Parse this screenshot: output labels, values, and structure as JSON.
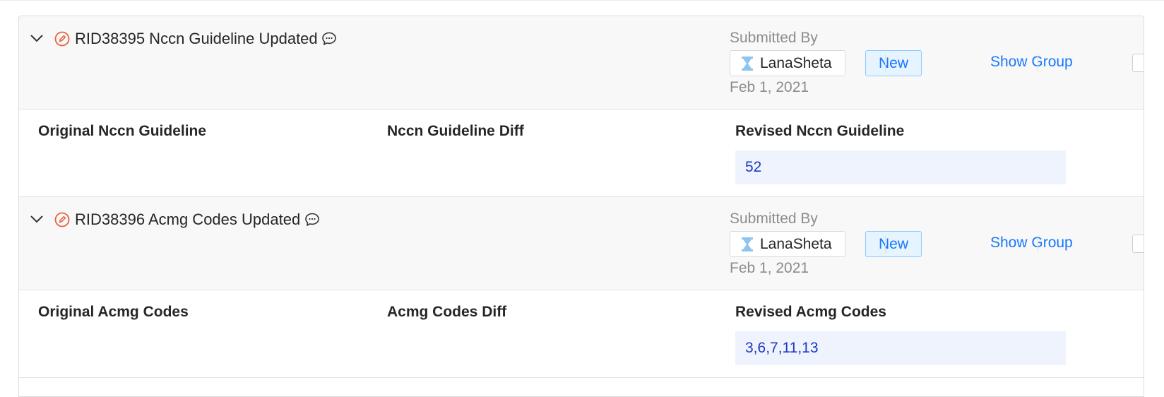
{
  "records": [
    {
      "title": "RID38395 Nccn Guideline Updated",
      "submitted_label": "Submitted By",
      "user": "LanaSheta",
      "status": "New",
      "show_group_label": "Show Group",
      "date": "Feb 1, 2021",
      "original_label": "Original Nccn Guideline",
      "diff_label": "Nccn Guideline Diff",
      "revised_label": "Revised Nccn Guideline",
      "revised_value": "52",
      "checked": false
    },
    {
      "title": "RID38396 Acmg Codes Updated",
      "submitted_label": "Submitted By",
      "user": "LanaSheta",
      "status": "New",
      "show_group_label": "Show Group",
      "date": "Feb 1, 2021",
      "original_label": "Original Acmg Codes",
      "diff_label": "Acmg Codes Diff",
      "revised_label": "Revised Acmg Codes",
      "revised_value": "3,6,7,11,13",
      "checked": false
    }
  ],
  "icons": {
    "collapse": "chevron-down-icon",
    "edit": "edit-icon",
    "comment": "comment-icon",
    "pending": "hourglass-icon"
  },
  "colors": {
    "accent": "#1677ff",
    "edit_icon": "#e8603c",
    "hourglass": "#8ec5ee",
    "revised_bg": "#eef3fd",
    "revised_text": "#1d39c4"
  }
}
